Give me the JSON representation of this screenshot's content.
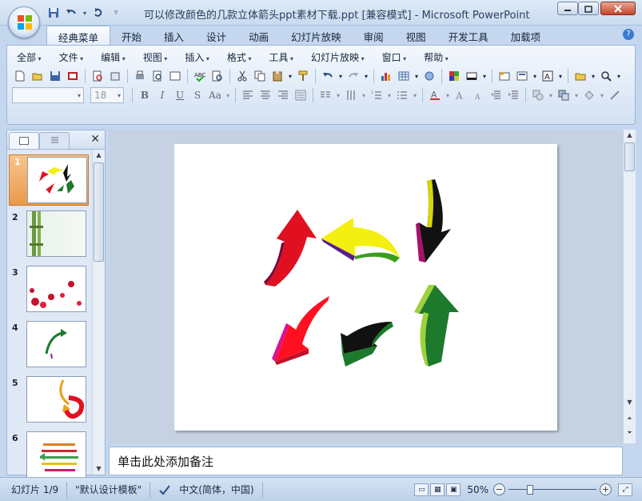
{
  "window": {
    "title": "可以修改颜色的几款立体箭头ppt素材下载.ppt [兼容模式] - Microsoft PowerPoint",
    "controls": [
      "minimize-icon",
      "restore-icon",
      "close-icon"
    ]
  },
  "quick_access": [
    "save-icon",
    "undo-icon",
    "redo-icon",
    "customize-icon"
  ],
  "ribbon_tabs": [
    "经典菜单",
    "开始",
    "插入",
    "设计",
    "动画",
    "幻灯片放映",
    "审阅",
    "视图",
    "开发工具",
    "加载项"
  ],
  "active_tab": "经典菜单",
  "menu": [
    "全部",
    "文件",
    "编辑",
    "视图",
    "插入",
    "格式",
    "工具",
    "幻灯片放映",
    "窗口",
    "帮助"
  ],
  "font": {
    "name": "",
    "size": "18"
  },
  "format_buttons": [
    "B",
    "I",
    "U",
    "S",
    "Aa"
  ],
  "slides": [
    {
      "number": "1",
      "selected": true
    },
    {
      "number": "2",
      "selected": false
    },
    {
      "number": "3",
      "selected": false
    },
    {
      "number": "4",
      "selected": false
    },
    {
      "number": "5",
      "selected": false
    },
    {
      "number": "6",
      "selected": false
    }
  ],
  "notes": {
    "placeholder": "单击此处添加备注"
  },
  "status": {
    "slide_info": "幻灯片 1/9",
    "theme": "\"默认设计模板\"",
    "language": "中文(简体，中国)",
    "zoom": "50%",
    "zoom_level": 0.5
  },
  "colors": {
    "accent_orange": "#e99a4a",
    "arrow_red": "#e01020",
    "arrow_yellow": "#f3ef10",
    "arrow_green": "#1d7a2c",
    "arrow_lime": "#9fd13a",
    "arrow_magenta": "#b01070"
  }
}
